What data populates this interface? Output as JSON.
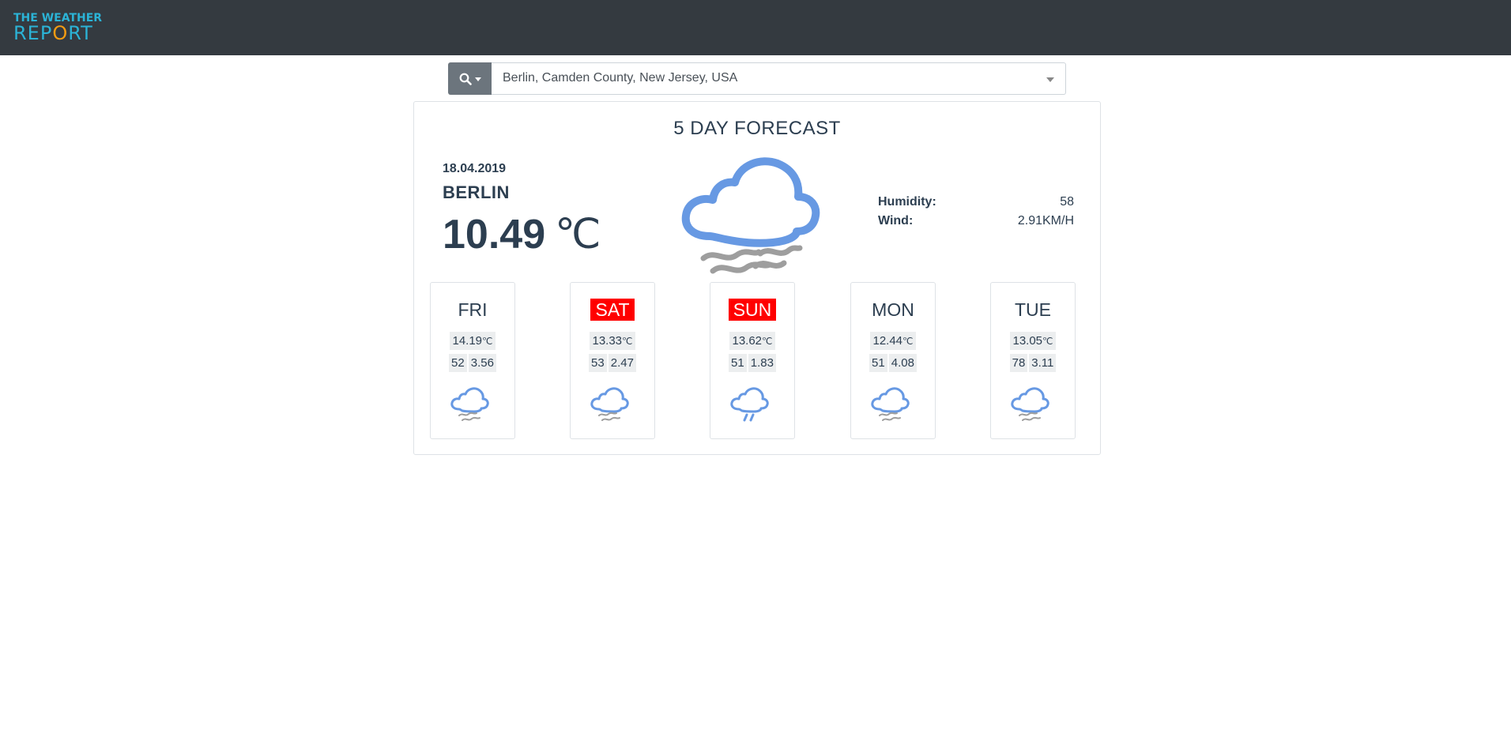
{
  "brand": {
    "line1": "THE WEATHER",
    "line2_a": "REP",
    "line2_sun": "O",
    "line2_b": "RT"
  },
  "search": {
    "location": "Berlin, Camden County, New Jersey, USA"
  },
  "forecast": {
    "title": "5 DAY FORECAST",
    "date": "18.04.2019",
    "city": "BERLIN",
    "temperature": "10.49",
    "unit": "℃",
    "icon": "cloud-fog-icon",
    "humidity_label": "Humidity:",
    "humidity": "58",
    "wind_label": "Wind:",
    "wind": "2.91KM/H"
  },
  "days": [
    {
      "name": "FRI",
      "weekend": false,
      "temp": "14.19",
      "unit": "℃",
      "humidity": "52",
      "wind": "3.56",
      "icon": "cloud-fog-icon"
    },
    {
      "name": "SAT",
      "weekend": true,
      "temp": "13.33",
      "unit": "℃",
      "humidity": "53",
      "wind": "2.47",
      "icon": "cloud-fog-icon"
    },
    {
      "name": "SUN",
      "weekend": true,
      "temp": "13.62",
      "unit": "℃",
      "humidity": "51",
      "wind": "1.83",
      "icon": "cloud-rain-icon"
    },
    {
      "name": "MON",
      "weekend": false,
      "temp": "12.44",
      "unit": "℃",
      "humidity": "51",
      "wind": "4.08",
      "icon": "cloud-fog-icon"
    },
    {
      "name": "TUE",
      "weekend": false,
      "temp": "13.05",
      "unit": "℃",
      "humidity": "78",
      "wind": "3.11",
      "icon": "cloud-fog-icon"
    }
  ],
  "colors": {
    "navbar": "#343a40",
    "brand": "#2bb3d6",
    "brand_sun": "#f39c12",
    "weekend": "#ff0000",
    "cloud": "#6799e3",
    "fog": "#9e9e9e"
  }
}
